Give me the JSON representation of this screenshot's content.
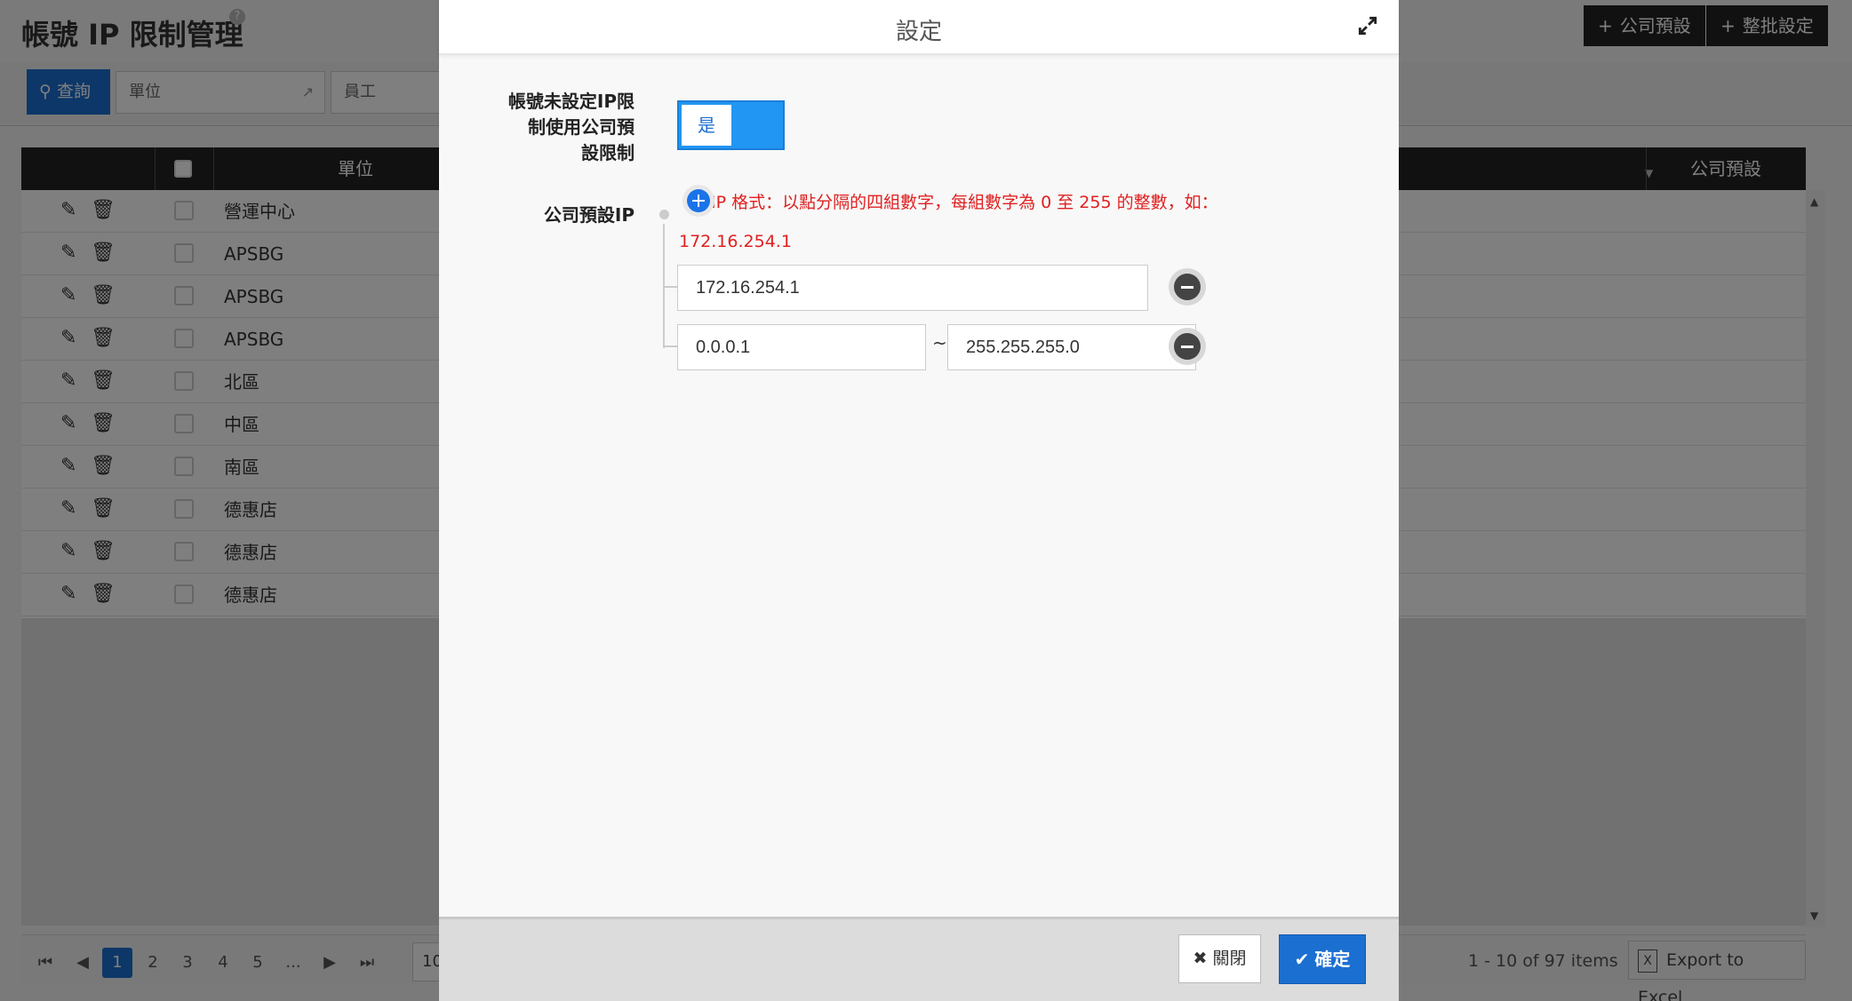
{
  "page": {
    "title": "帳號 IP 限制管理",
    "help_icon": "?",
    "buttons": [
      "公司預設",
      "整批設定"
    ],
    "search_label": "查詢",
    "filters": [
      "單位",
      "員工"
    ],
    "grid_headers": {
      "unit": "單位",
      "company_default": "公司預設"
    },
    "rows": [
      "營運中心",
      "APSBG",
      "APSBG",
      "APSBG",
      "北區",
      "中區",
      "南區",
      "德惠店",
      "德惠店",
      "德惠店"
    ],
    "pager": {
      "pages": [
        "1",
        "2",
        "3",
        "4",
        "5",
        "..."
      ],
      "active_page": "1",
      "page_size": "10",
      "info": "1 - 10 of 97 items",
      "export_label": "Export to Excel"
    }
  },
  "modal": {
    "title": "設定",
    "no_ip_label": "帳號未設定IP限\n制使用公司預\n設限制",
    "toggle_value": "是",
    "company_ip_label": "公司預設IP",
    "hint": "IP 格式：以點分隔的四組數字，每組數字為 0 至 255 的整數，如：172.16.254.1",
    "ip_single": "172.16.254.1",
    "ip_range_start": "0.0.0.1",
    "range_separator": "~",
    "ip_range_end": "255.255.255.0",
    "close_label": "關閉",
    "ok_label": "確定"
  },
  "colors": {
    "primary": "#1a6fd1",
    "toggle": "#2196f3",
    "hint": "#e02020"
  }
}
